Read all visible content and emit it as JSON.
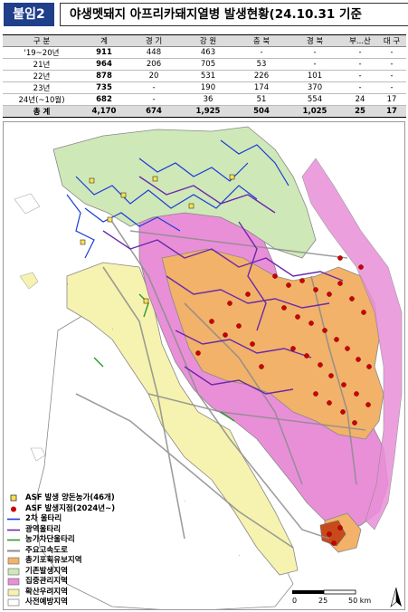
{
  "header": {
    "badge": "붙임2",
    "title": "야생멧돼지 아프리카돼지열병 발생현황(24.10.31 기준"
  },
  "table": {
    "headers": [
      "구 분",
      "계",
      "경 기",
      "강 원",
      "충 북",
      "경 북",
      "부...산",
      "대 구"
    ],
    "rows": [
      [
        "'19~20년",
        "911",
        "448",
        "463",
        "-",
        "-",
        "-",
        "-"
      ],
      [
        "21년",
        "964",
        "206",
        "705",
        "53",
        "-",
        "-",
        "-"
      ],
      [
        "22년",
        "878",
        "20",
        "531",
        "226",
        "101",
        "-",
        "-"
      ],
      [
        "23년",
        "735",
        "-",
        "190",
        "174",
        "370",
        "-",
        "-"
      ],
      [
        "24년(~10월)",
        "682",
        "-",
        "36",
        "51",
        "554",
        "24",
        "17"
      ]
    ],
    "total": [
      "총 계",
      "4,170",
      "674",
      "1,925",
      "504",
      "1,025",
      "25",
      "17"
    ]
  },
  "legend": [
    {
      "icon": "farm-square-icon",
      "label": "ASF 발생 양돈농가(46개)"
    },
    {
      "icon": "red-dot-icon",
      "label": "ASF 발생지점(2024년~)"
    },
    {
      "icon": "blue-line-icon",
      "label": "2차 울타리"
    },
    {
      "icon": "purple-line-icon",
      "label": "광역울타리"
    },
    {
      "icon": "green-line-icon",
      "label": "농가차단울타리"
    },
    {
      "icon": "gray-line-icon",
      "label": "주요고속도로"
    },
    {
      "icon": "orange-area-icon",
      "label": "총기포획유보지역"
    },
    {
      "icon": "green-area-icon",
      "label": "기존발생지역"
    },
    {
      "icon": "pink-area-icon",
      "label": "집중관리지역"
    },
    {
      "icon": "yellow-area-icon",
      "label": "확산우려지역"
    },
    {
      "icon": "white-area-icon",
      "label": "사전예방지역"
    }
  ],
  "scale": {
    "labels": [
      "0",
      "25",
      "50 km"
    ]
  },
  "colors": {
    "badge": "#1f3f8a",
    "existing": "#cfe8b8",
    "intensive": "#e98fd8",
    "withhold": "#f2b26a",
    "concern": "#f6f3b0",
    "prevent": "#ffffff",
    "fence2": "#1a3cd8",
    "wide_fence": "#6a2aa8",
    "farm_fence": "#2a9a2a",
    "highway": "#8c8c8c",
    "dot": "#cc0000"
  }
}
